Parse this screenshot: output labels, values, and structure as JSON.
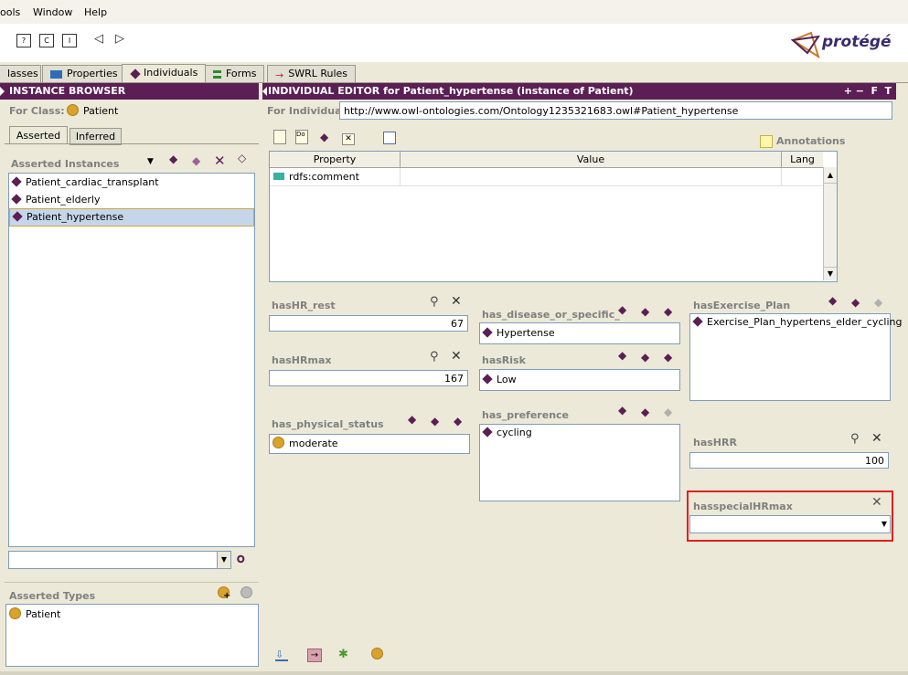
{
  "menu": {
    "items": [
      "ools",
      "Window",
      "Help"
    ]
  },
  "toolbar": {
    "logo_text": "protégé"
  },
  "tabs": [
    {
      "label": "lasses"
    },
    {
      "label": "Properties"
    },
    {
      "label": "Individuals"
    },
    {
      "label": "Forms"
    },
    {
      "label": "SWRL Rules"
    }
  ],
  "instance_browser": {
    "title": "INSTANCE BROWSER",
    "for_class_label": "For Class:",
    "for_class_value": "Patient",
    "subtabs": [
      "Asserted",
      "Inferred"
    ],
    "asserted_instances_label": "Asserted Instances",
    "instances": [
      "Patient_cardiac_transplant",
      "Patient_elderly",
      "Patient_hypertense"
    ],
    "selected_index": 2,
    "search_value": "",
    "asserted_types_label": "Asserted Types",
    "asserted_types": [
      "Patient"
    ]
  },
  "individual_editor": {
    "title": "INDIVIDUAL EDITOR for Patient_hypertense   (instance of Patient)",
    "header_buttons": [
      "+",
      "−",
      "F",
      "T"
    ],
    "for_individual_label": "For Individual:",
    "for_individual_value": "http://www.owl-ontologies.com/Ontology1235321683.owl#Patient_hypertense",
    "annotations_label": "Annotations",
    "table": {
      "headers": [
        "Property",
        "Value",
        "Lang"
      ],
      "rows": [
        {
          "property": "rdfs:comment",
          "value": "",
          "lang": ""
        }
      ]
    },
    "props": {
      "hasHR_rest": {
        "label": "hasHR_rest",
        "value": "67"
      },
      "hasHRmax": {
        "label": "hasHRmax",
        "value": "167"
      },
      "has_physical_status": {
        "label": "has_physical_status",
        "value": "moderate"
      },
      "has_disease": {
        "label": "has_disease_or_specific_",
        "value": "Hypertense"
      },
      "hasRisk": {
        "label": "hasRisk",
        "value": "Low"
      },
      "has_preference": {
        "label": "has_preference",
        "value": "cycling"
      },
      "hasExercise_Plan": {
        "label": "hasExercise_Plan",
        "value": "Exercise_Plan_hypertens_elder_cycling"
      },
      "hasHRR": {
        "label": "hasHRR",
        "value": "100"
      },
      "hasspecialHRmax": {
        "label": "hasspecialHRmax",
        "value": ""
      }
    }
  },
  "colors": {
    "header": "#5b1e55",
    "highlight": "#e02020",
    "selection": "#c5d5ea"
  }
}
